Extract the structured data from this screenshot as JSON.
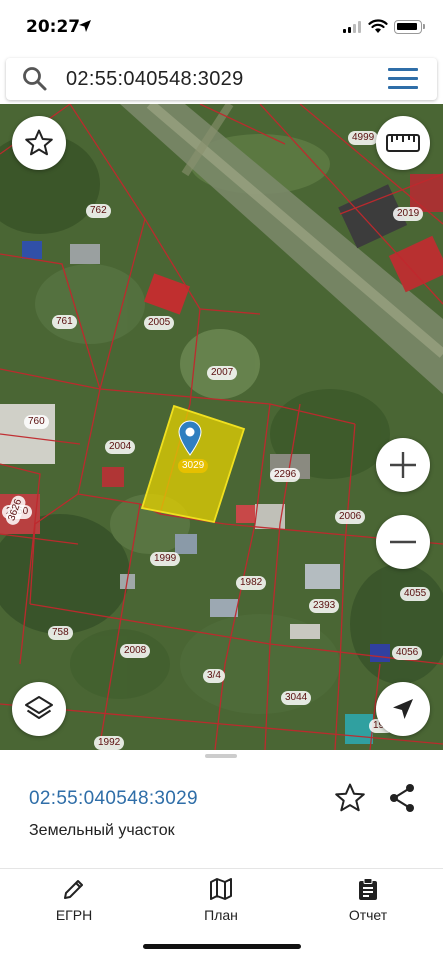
{
  "status": {
    "time": "20:27"
  },
  "search": {
    "query": "02:55:040548:3029"
  },
  "map": {
    "plots": [
      "762",
      "4999",
      "2019",
      "2005",
      "761",
      "2007",
      "760",
      "2004",
      "3029",
      "2296",
      "2350",
      "3626",
      "2006",
      "1999",
      "1982",
      "4055",
      "758",
      "2393",
      "2008",
      "4056",
      "3/4",
      "3044",
      "1992",
      "192"
    ],
    "selected_plot": "3029",
    "buttons": {
      "favorite": "star-icon",
      "ruler": "ruler-icon",
      "zoom_in": "plus-icon",
      "zoom_out": "minus-icon",
      "layers": "layers-icon",
      "locate": "navigation-arrow-icon"
    }
  },
  "sheet": {
    "cad_number": "02:55:040548:3029",
    "type": "Земельный участок"
  },
  "tabs": [
    {
      "label": "ЕГРН",
      "icon": "pencil-icon"
    },
    {
      "label": "План",
      "icon": "map-icon"
    },
    {
      "label": "Отчет",
      "icon": "clipboard-icon"
    }
  ],
  "colors": {
    "accent": "#2f6ea8",
    "selected_plot": "#e6c000",
    "boundary": "#c0282d"
  }
}
